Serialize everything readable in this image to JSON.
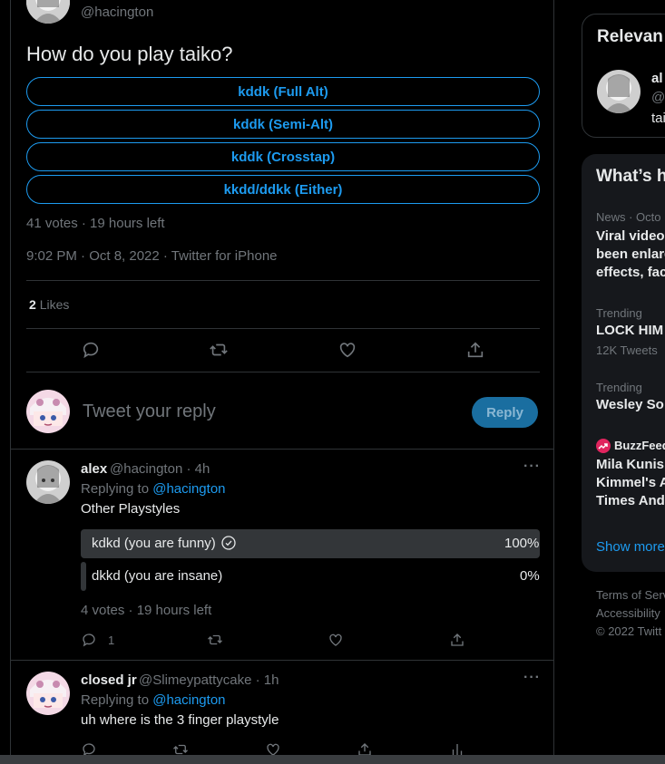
{
  "tweet": {
    "handle": "@hacington",
    "question": "How do you play taiko?",
    "poll_options": [
      "kddk (Full Alt)",
      "kddk (Semi-Alt)",
      "kddk (Crosstap)",
      "kkdd/ddkk (Either)"
    ],
    "poll_meta": "41 votes · 19 hours left",
    "timestamp": "9:02 PM · Oct 8, 2022 · Twitter for iPhone",
    "likes_count": "2",
    "likes_label": "Likes"
  },
  "reply_box": {
    "placeholder": "Tweet your reply",
    "button": "Reply"
  },
  "replies": [
    {
      "name": "alex",
      "handle_time": "@hacington · 4h",
      "replying_prefix": "Replying to",
      "replying_to": "@hacington",
      "text": "Other Playstyles",
      "poll": [
        {
          "label": "kdkd (you are funny)",
          "pct": "100%",
          "winner": true,
          "fraction": 1.0
        },
        {
          "label": "dkkd (you are insane)",
          "pct": "0%",
          "winner": false,
          "fraction": 0.0
        }
      ],
      "poll_meta": "4 votes · 19 hours left",
      "reply_count": "1"
    },
    {
      "name": "closed jr",
      "handle_time": "@Slimeypattycake · 1h",
      "replying_prefix": "Replying to",
      "replying_to": "@hacington",
      "text": "uh where is the 3 finger playstyle"
    }
  ],
  "sidebar": {
    "relevant": {
      "title": "Relevan",
      "name": "al",
      "handle": "@",
      "bio": "tai"
    },
    "whats_happening": {
      "title": "What’s h",
      "trends": [
        {
          "category": "News · Octo",
          "title_lines": [
            "Viral video",
            "been enlarg",
            "effects, fac"
          ]
        },
        {
          "category": "Trending",
          "title_lines": [
            "LOCK HIM"
          ],
          "sub": "12K Tweets"
        },
        {
          "category": "Trending",
          "title_lines": [
            "Wesley So"
          ]
        },
        {
          "category": "BuzzFeed",
          "title_lines": [
            "Mila Kunis",
            "Kimmel's A",
            "Times And"
          ]
        }
      ],
      "show_more": "Show more"
    },
    "footer": [
      "Terms of Serv",
      "Accessibility",
      "© 2022 Twitt"
    ]
  },
  "colors": {
    "accent": "#1d9bf0",
    "background": "#000000",
    "panel": "#16181c",
    "muted": "#71767b"
  }
}
